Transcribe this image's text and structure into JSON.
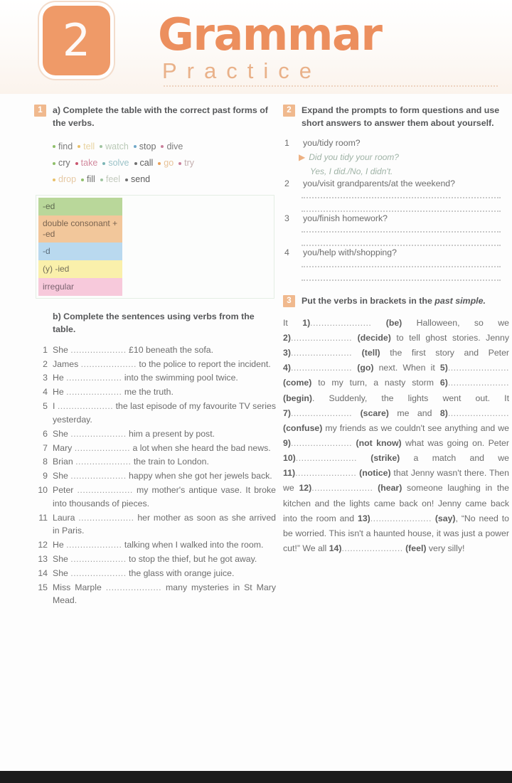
{
  "header": {
    "unit_number": "2",
    "title": "Grammar",
    "subtitle": "Practice"
  },
  "exercise1": {
    "number": "1",
    "instruction_a": "a) Complete the table with the correct past forms of the verbs.",
    "verbs": [
      {
        "word": "find",
        "color": "#7d7d7d"
      },
      {
        "word": "tell",
        "color": "#e8d3a0"
      },
      {
        "word": "watch",
        "color": "#b9c9b6"
      },
      {
        "word": "stop",
        "color": "#6f6f6f"
      },
      {
        "word": "dive",
        "color": "#7d7d7d"
      },
      {
        "word": "cry",
        "color": "#6f6f6f"
      },
      {
        "word": "take",
        "color": "#d28a9e"
      },
      {
        "word": "solve",
        "color": "#9cc3c8"
      },
      {
        "word": "call",
        "color": "#5d5d5d"
      },
      {
        "word": "go",
        "color": "#e8c39a"
      },
      {
        "word": "try",
        "color": "#c3aeae"
      },
      {
        "word": "drop",
        "color": "#e6c9a4"
      },
      {
        "word": "fill",
        "color": "#6f6f6f"
      },
      {
        "word": "feel",
        "color": "#c2c9bd"
      },
      {
        "word": "send",
        "color": "#5d5d5d"
      }
    ],
    "bullet_colors": [
      "#8fbf6a",
      "#e8c06a",
      "#9fc4a0",
      "#6fa8c8",
      "#c97f9a",
      "#8fbf6a",
      "#c9566f",
      "#7bb5b5",
      "#6f6f6f",
      "#e8a05a",
      "#c97f9a",
      "#e8c06a",
      "#8fbf6a",
      "#9fc4a0",
      "#6f6f6f"
    ],
    "table_rows": [
      {
        "label": "-ed",
        "color": "#b9d79a"
      },
      {
        "label": "double consonant + -ed",
        "color": "#f2c79b"
      },
      {
        "label": "-d",
        "color": "#b9d9ef"
      },
      {
        "label": "(y) -ied",
        "color": "#faf0ab"
      },
      {
        "label": "irregular",
        "color": "#f7c9db"
      }
    ],
    "instruction_b": "b) Complete the sentences using verbs from the table.",
    "dots": "....................",
    "sentences": [
      {
        "n": "1",
        "before": "She ",
        "after": " £10 beneath the sofa."
      },
      {
        "n": "2",
        "before": "James ",
        "after": " to the police to report the incident."
      },
      {
        "n": "3",
        "before": "He ",
        "after": " into the swimming pool twice."
      },
      {
        "n": "4",
        "before": "He ",
        "after": " me the truth."
      },
      {
        "n": "5",
        "before": "I ",
        "after": " the last episode of my favourite TV series yesterday."
      },
      {
        "n": "6",
        "before": "She ",
        "after": " him a present by post."
      },
      {
        "n": "7",
        "before": "Mary ",
        "after": " a lot when she heard the bad news."
      },
      {
        "n": "8",
        "before": "Brian ",
        "after": " the train to London."
      },
      {
        "n": "9",
        "before": "She ",
        "after": " happy when she got her jewels back."
      },
      {
        "n": "10",
        "before": "Peter ",
        "after": " my mother's antique vase. It broke into thousands of pieces."
      },
      {
        "n": "11",
        "before": "Laura ",
        "after": " her mother as soon as she arrived in Paris."
      },
      {
        "n": "12",
        "before": "He ",
        "after": " talking when I walked into the room."
      },
      {
        "n": "13",
        "before": "She ",
        "after": " to stop the thief, but he got away."
      },
      {
        "n": "14",
        "before": "She ",
        "after": " the glass with orange juice."
      },
      {
        "n": "15",
        "before": "Miss Marple ",
        "after": " many mysteries in St Mary Mead."
      }
    ]
  },
  "exercise2": {
    "number": "2",
    "instruction": "Expand the prompts to form questions and use short answers to answer them about yourself.",
    "items": [
      {
        "n": "1",
        "prompt": "you/tidy room?",
        "example_question": "Did you tidy your room?",
        "example_answer": "Yes, I did./No, I didn't.",
        "has_example": true
      },
      {
        "n": "2",
        "prompt": "you/visit grandparents/at the weekend?",
        "has_example": false
      },
      {
        "n": "3",
        "prompt": "you/finish homework?",
        "has_example": false
      },
      {
        "n": "4",
        "prompt": "you/help with/shopping?",
        "has_example": false
      }
    ],
    "arrow_glyph": "▶"
  },
  "exercise3": {
    "number": "3",
    "instruction_plain": "Put the verbs in brackets in the ",
    "instruction_italic": "past simple.",
    "dots": "......................",
    "passage_parts": [
      {
        "type": "text",
        "value": "It "
      },
      {
        "type": "gap",
        "value": "1)"
      },
      {
        "type": "dots"
      },
      {
        "type": "bold",
        "value": " (be)"
      },
      {
        "type": "text",
        "value": " Halloween, so we "
      },
      {
        "type": "gap",
        "value": "2)"
      },
      {
        "type": "dots"
      },
      {
        "type": "bold",
        "value": " (decide)"
      },
      {
        "type": "text",
        "value": " to tell ghost stories. Jenny "
      },
      {
        "type": "gap",
        "value": "3)"
      },
      {
        "type": "dots"
      },
      {
        "type": "bold",
        "value": " (tell)"
      },
      {
        "type": "text",
        "value": " the first story and Peter "
      },
      {
        "type": "gap",
        "value": "4)"
      },
      {
        "type": "dots"
      },
      {
        "type": "bold",
        "value": " (go)"
      },
      {
        "type": "text",
        "value": " next. When it "
      },
      {
        "type": "gap",
        "value": "5)"
      },
      {
        "type": "dots"
      },
      {
        "type": "bold",
        "value": " (come)"
      },
      {
        "type": "text",
        "value": " to my turn, a nasty storm "
      },
      {
        "type": "gap",
        "value": "6)"
      },
      {
        "type": "dots"
      },
      {
        "type": "bold",
        "value": " (begin)"
      },
      {
        "type": "text",
        "value": ". Suddenly, the lights went out. It "
      },
      {
        "type": "gap",
        "value": "7)"
      },
      {
        "type": "dots"
      },
      {
        "type": "bold",
        "value": " (scare)"
      },
      {
        "type": "text",
        "value": " me and "
      },
      {
        "type": "gap",
        "value": "8)"
      },
      {
        "type": "dots"
      },
      {
        "type": "bold",
        "value": " (confuse)"
      },
      {
        "type": "text",
        "value": " my friends as we couldn't see anything and we "
      },
      {
        "type": "gap",
        "value": "9)"
      },
      {
        "type": "dots"
      },
      {
        "type": "bold",
        "value": " (not know)"
      },
      {
        "type": "text",
        "value": " what was going on. Peter "
      },
      {
        "type": "gap",
        "value": "10)"
      },
      {
        "type": "dots"
      },
      {
        "type": "bold",
        "value": " (strike)"
      },
      {
        "type": "text",
        "value": " a match and we "
      },
      {
        "type": "gap",
        "value": "11)"
      },
      {
        "type": "dots"
      },
      {
        "type": "bold",
        "value": " (notice)"
      },
      {
        "type": "text",
        "value": " that Jenny wasn't there. Then we "
      },
      {
        "type": "gap",
        "value": "12)"
      },
      {
        "type": "dots"
      },
      {
        "type": "bold",
        "value": " (hear)"
      },
      {
        "type": "text",
        "value": " someone laughing in the kitchen and the lights came back on! Jenny came back into the room and "
      },
      {
        "type": "gap",
        "value": "13)"
      },
      {
        "type": "dots"
      },
      {
        "type": "bold",
        "value": " (say)"
      },
      {
        "type": "text",
        "value": ", “No need to be worried. This isn't a haunted house, it was just a power cut!” We all "
      },
      {
        "type": "gap",
        "value": "14)"
      },
      {
        "type": "dots"
      },
      {
        "type": "bold",
        "value": " (feel)"
      },
      {
        "type": "text",
        "value": " very silly!"
      }
    ]
  }
}
